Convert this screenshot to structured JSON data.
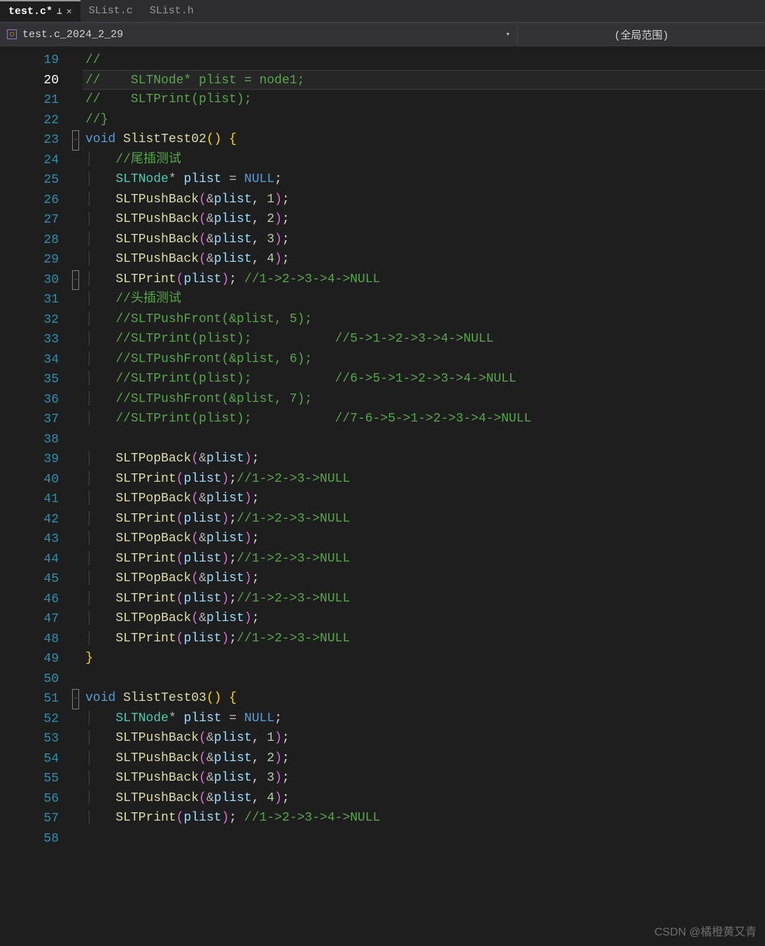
{
  "tabs": [
    {
      "label": "test.c*",
      "active": true,
      "pinned": true,
      "closable": true
    },
    {
      "label": "SList.c",
      "active": false
    },
    {
      "label": "SList.h",
      "active": false
    }
  ],
  "nav": {
    "file": "test.c_2024_2_29",
    "scope": "(全局范围)"
  },
  "line_start": 19,
  "current_line": 20,
  "lines": [
    {
      "n": 19,
      "fold": "",
      "tokens": [
        [
          "c-comment",
          "//"
        ]
      ]
    },
    {
      "n": 20,
      "fold": "",
      "tokens": [
        [
          "c-comment",
          "//    SLTNode* plist = node1;"
        ]
      ]
    },
    {
      "n": 21,
      "fold": "",
      "tokens": [
        [
          "c-comment",
          "//    SLTPrint(plist);"
        ]
      ]
    },
    {
      "n": 22,
      "fold": "",
      "tokens": [
        [
          "c-comment",
          "//}"
        ]
      ]
    },
    {
      "n": 23,
      "fold": "-",
      "tokens": [
        [
          "c-keyword",
          "void"
        ],
        [
          "",
          " "
        ],
        [
          "c-func",
          "SlistTest02"
        ],
        [
          "bracket1",
          "()"
        ],
        [
          "",
          " "
        ],
        [
          "bracket1",
          "{"
        ]
      ]
    },
    {
      "n": 24,
      "fold": "",
      "indent": 1,
      "tokens": [
        [
          "c-comment",
          "//尾插测试"
        ]
      ]
    },
    {
      "n": 25,
      "fold": "",
      "indent": 1,
      "tokens": [
        [
          "c-type",
          "SLTNode"
        ],
        [
          "c-op",
          "*"
        ],
        [
          "",
          " "
        ],
        [
          "c-ident",
          "plist"
        ],
        [
          "",
          " "
        ],
        [
          "c-op",
          "="
        ],
        [
          "",
          " "
        ],
        [
          "c-keyword",
          "NULL"
        ],
        [
          "c-punc",
          ";"
        ]
      ]
    },
    {
      "n": 26,
      "fold": "",
      "indent": 1,
      "tokens": [
        [
          "c-func",
          "SLTPushBack"
        ],
        [
          "bracket2",
          "("
        ],
        [
          "c-op",
          "&"
        ],
        [
          "c-ident",
          "plist"
        ],
        [
          "c-punc",
          ", "
        ],
        [
          "c-num",
          "1"
        ],
        [
          "bracket2",
          ")"
        ],
        [
          "c-punc",
          ";"
        ]
      ]
    },
    {
      "n": 27,
      "fold": "",
      "indent": 1,
      "tokens": [
        [
          "c-func",
          "SLTPushBack"
        ],
        [
          "bracket2",
          "("
        ],
        [
          "c-op",
          "&"
        ],
        [
          "c-ident",
          "plist"
        ],
        [
          "c-punc",
          ", "
        ],
        [
          "c-num",
          "2"
        ],
        [
          "bracket2",
          ")"
        ],
        [
          "c-punc",
          ";"
        ]
      ]
    },
    {
      "n": 28,
      "fold": "",
      "indent": 1,
      "tokens": [
        [
          "c-func",
          "SLTPushBack"
        ],
        [
          "bracket2",
          "("
        ],
        [
          "c-op",
          "&"
        ],
        [
          "c-ident",
          "plist"
        ],
        [
          "c-punc",
          ", "
        ],
        [
          "c-num",
          "3"
        ],
        [
          "bracket2",
          ")"
        ],
        [
          "c-punc",
          ";"
        ]
      ]
    },
    {
      "n": 29,
      "fold": "",
      "indent": 1,
      "tokens": [
        [
          "c-func",
          "SLTPushBack"
        ],
        [
          "bracket2",
          "("
        ],
        [
          "c-op",
          "&"
        ],
        [
          "c-ident",
          "plist"
        ],
        [
          "c-punc",
          ", "
        ],
        [
          "c-num",
          "4"
        ],
        [
          "bracket2",
          ")"
        ],
        [
          "c-punc",
          ";"
        ]
      ]
    },
    {
      "n": 30,
      "fold": "-",
      "indent": 1,
      "tokens": [
        [
          "c-func",
          "SLTPrint"
        ],
        [
          "bracket2",
          "("
        ],
        [
          "c-ident",
          "plist"
        ],
        [
          "bracket2",
          ")"
        ],
        [
          "c-punc",
          "; "
        ],
        [
          "c-comment",
          "//1->2->3->4->NULL"
        ]
      ]
    },
    {
      "n": 31,
      "fold": "",
      "indent": 1,
      "tokens": [
        [
          "c-comment",
          "//头插测试"
        ]
      ]
    },
    {
      "n": 32,
      "fold": "",
      "indent": 1,
      "tokens": [
        [
          "c-comment",
          "//SLTPushFront(&plist, 5);"
        ]
      ]
    },
    {
      "n": 33,
      "fold": "",
      "indent": 1,
      "tokens": [
        [
          "c-comment",
          "//SLTPrint(plist);           //5->1->2->3->4->NULL"
        ]
      ]
    },
    {
      "n": 34,
      "fold": "",
      "indent": 1,
      "tokens": [
        [
          "c-comment",
          "//SLTPushFront(&plist, 6);"
        ]
      ]
    },
    {
      "n": 35,
      "fold": "",
      "indent": 1,
      "tokens": [
        [
          "c-comment",
          "//SLTPrint(plist);           //6->5->1->2->3->4->NULL"
        ]
      ]
    },
    {
      "n": 36,
      "fold": "",
      "indent": 1,
      "tokens": [
        [
          "c-comment",
          "//SLTPushFront(&plist, 7);"
        ]
      ]
    },
    {
      "n": 37,
      "fold": "",
      "indent": 1,
      "tokens": [
        [
          "c-comment",
          "//SLTPrint(plist);           //7-6->5->1->2->3->4->NULL"
        ]
      ]
    },
    {
      "n": 38,
      "fold": "",
      "indent": 0,
      "tokens": [
        [
          "",
          ""
        ]
      ]
    },
    {
      "n": 39,
      "fold": "",
      "indent": 1,
      "tokens": [
        [
          "c-func",
          "SLTPopBack"
        ],
        [
          "bracket2",
          "("
        ],
        [
          "c-op",
          "&"
        ],
        [
          "c-ident",
          "plist"
        ],
        [
          "bracket2",
          ")"
        ],
        [
          "c-punc",
          ";"
        ]
      ]
    },
    {
      "n": 40,
      "fold": "",
      "indent": 1,
      "tokens": [
        [
          "c-func",
          "SLTPrint"
        ],
        [
          "bracket2",
          "("
        ],
        [
          "c-ident",
          "plist"
        ],
        [
          "bracket2",
          ")"
        ],
        [
          "c-punc",
          ";"
        ],
        [
          "c-comment",
          "//1->2->3->NULL"
        ]
      ]
    },
    {
      "n": 41,
      "fold": "",
      "indent": 1,
      "tokens": [
        [
          "c-func",
          "SLTPopBack"
        ],
        [
          "bracket2",
          "("
        ],
        [
          "c-op",
          "&"
        ],
        [
          "c-ident",
          "plist"
        ],
        [
          "bracket2",
          ")"
        ],
        [
          "c-punc",
          ";"
        ]
      ]
    },
    {
      "n": 42,
      "fold": "",
      "indent": 1,
      "tokens": [
        [
          "c-func",
          "SLTPrint"
        ],
        [
          "bracket2",
          "("
        ],
        [
          "c-ident",
          "plist"
        ],
        [
          "bracket2",
          ")"
        ],
        [
          "c-punc",
          ";"
        ],
        [
          "c-comment",
          "//1->2->3->NULL"
        ]
      ]
    },
    {
      "n": 43,
      "fold": "",
      "indent": 1,
      "tokens": [
        [
          "c-func",
          "SLTPopBack"
        ],
        [
          "bracket2",
          "("
        ],
        [
          "c-op",
          "&"
        ],
        [
          "c-ident",
          "plist"
        ],
        [
          "bracket2",
          ")"
        ],
        [
          "c-punc",
          ";"
        ]
      ]
    },
    {
      "n": 44,
      "fold": "",
      "indent": 1,
      "tokens": [
        [
          "c-func",
          "SLTPrint"
        ],
        [
          "bracket2",
          "("
        ],
        [
          "c-ident",
          "plist"
        ],
        [
          "bracket2",
          ")"
        ],
        [
          "c-punc",
          ";"
        ],
        [
          "c-comment",
          "//1->2->3->NULL"
        ]
      ]
    },
    {
      "n": 45,
      "fold": "",
      "indent": 1,
      "tokens": [
        [
          "c-func",
          "SLTPopBack"
        ],
        [
          "bracket2",
          "("
        ],
        [
          "c-op",
          "&"
        ],
        [
          "c-ident",
          "plist"
        ],
        [
          "bracket2",
          ")"
        ],
        [
          "c-punc",
          ";"
        ]
      ]
    },
    {
      "n": 46,
      "fold": "",
      "indent": 1,
      "tokens": [
        [
          "c-func",
          "SLTPrint"
        ],
        [
          "bracket2",
          "("
        ],
        [
          "c-ident",
          "plist"
        ],
        [
          "bracket2",
          ")"
        ],
        [
          "c-punc",
          ";"
        ],
        [
          "c-comment",
          "//1->2->3->NULL"
        ]
      ]
    },
    {
      "n": 47,
      "fold": "",
      "indent": 1,
      "tokens": [
        [
          "c-func",
          "SLTPopBack"
        ],
        [
          "bracket2",
          "("
        ],
        [
          "c-op",
          "&"
        ],
        [
          "c-ident",
          "plist"
        ],
        [
          "bracket2",
          ")"
        ],
        [
          "c-punc",
          ";"
        ]
      ]
    },
    {
      "n": 48,
      "fold": "",
      "indent": 1,
      "tokens": [
        [
          "c-func",
          "SLTPrint"
        ],
        [
          "bracket2",
          "("
        ],
        [
          "c-ident",
          "plist"
        ],
        [
          "bracket2",
          ")"
        ],
        [
          "c-punc",
          ";"
        ],
        [
          "c-comment",
          "//1->2->3->NULL"
        ]
      ]
    },
    {
      "n": 49,
      "fold": "",
      "indent": 0,
      "tokens": [
        [
          "bracket1",
          "}"
        ]
      ]
    },
    {
      "n": 50,
      "fold": "",
      "indent": 0,
      "tokens": [
        [
          "",
          ""
        ]
      ]
    },
    {
      "n": 51,
      "fold": "-",
      "tokens": [
        [
          "c-keyword",
          "void"
        ],
        [
          "",
          " "
        ],
        [
          "c-func",
          "SlistTest03"
        ],
        [
          "bracket1",
          "()"
        ],
        [
          "",
          " "
        ],
        [
          "bracket1",
          "{"
        ]
      ]
    },
    {
      "n": 52,
      "fold": "",
      "indent": 1,
      "tokens": [
        [
          "c-type",
          "SLTNode"
        ],
        [
          "c-op",
          "*"
        ],
        [
          "",
          " "
        ],
        [
          "c-ident",
          "plist"
        ],
        [
          "",
          " "
        ],
        [
          "c-op",
          "="
        ],
        [
          "",
          " "
        ],
        [
          "c-keyword",
          "NULL"
        ],
        [
          "c-punc",
          ";"
        ]
      ]
    },
    {
      "n": 53,
      "fold": "",
      "indent": 1,
      "tokens": [
        [
          "c-func",
          "SLTPushBack"
        ],
        [
          "bracket2",
          "("
        ],
        [
          "c-op",
          "&"
        ],
        [
          "c-ident",
          "plist"
        ],
        [
          "c-punc",
          ", "
        ],
        [
          "c-num",
          "1"
        ],
        [
          "bracket2",
          ")"
        ],
        [
          "c-punc",
          ";"
        ]
      ]
    },
    {
      "n": 54,
      "fold": "",
      "indent": 1,
      "tokens": [
        [
          "c-func",
          "SLTPushBack"
        ],
        [
          "bracket2",
          "("
        ],
        [
          "c-op",
          "&"
        ],
        [
          "c-ident",
          "plist"
        ],
        [
          "c-punc",
          ", "
        ],
        [
          "c-num",
          "2"
        ],
        [
          "bracket2",
          ")"
        ],
        [
          "c-punc",
          ";"
        ]
      ]
    },
    {
      "n": 55,
      "fold": "",
      "indent": 1,
      "tokens": [
        [
          "c-func",
          "SLTPushBack"
        ],
        [
          "bracket2",
          "("
        ],
        [
          "c-op",
          "&"
        ],
        [
          "c-ident",
          "plist"
        ],
        [
          "c-punc",
          ", "
        ],
        [
          "c-num",
          "3"
        ],
        [
          "bracket2",
          ")"
        ],
        [
          "c-punc",
          ";"
        ]
      ]
    },
    {
      "n": 56,
      "fold": "",
      "indent": 1,
      "tokens": [
        [
          "c-func",
          "SLTPushBack"
        ],
        [
          "bracket2",
          "("
        ],
        [
          "c-op",
          "&"
        ],
        [
          "c-ident",
          "plist"
        ],
        [
          "c-punc",
          ", "
        ],
        [
          "c-num",
          "4"
        ],
        [
          "bracket2",
          ")"
        ],
        [
          "c-punc",
          ";"
        ]
      ]
    },
    {
      "n": 57,
      "fold": "",
      "indent": 1,
      "tokens": [
        [
          "c-func",
          "SLTPrint"
        ],
        [
          "bracket2",
          "("
        ],
        [
          "c-ident",
          "plist"
        ],
        [
          "bracket2",
          ")"
        ],
        [
          "c-punc",
          "; "
        ],
        [
          "c-comment",
          "//1->2->3->4->NULL"
        ]
      ]
    },
    {
      "n": 58,
      "fold": "",
      "indent": 0,
      "tokens": [
        [
          "",
          ""
        ]
      ]
    }
  ],
  "watermark": "CSDN @橘橙黄又青"
}
